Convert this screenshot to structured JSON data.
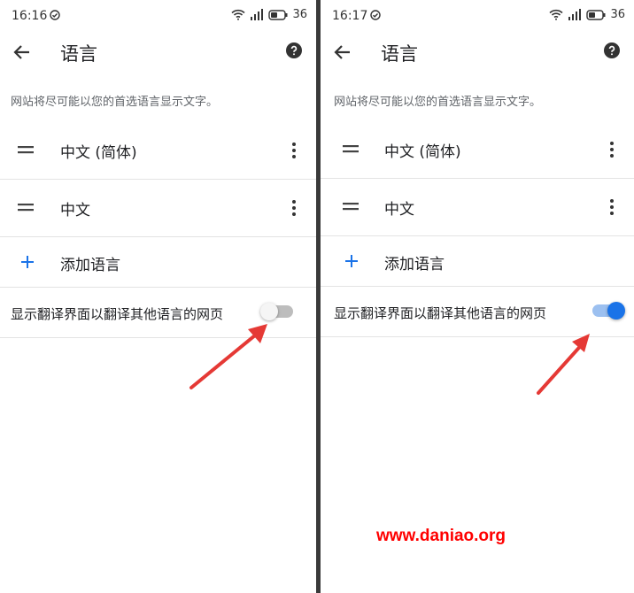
{
  "left": {
    "status": {
      "time": "16:16",
      "battery": "36"
    },
    "title": "语言",
    "description": "网站将尽可能以您的首选语言显示文字。",
    "languages": [
      {
        "label": "中文 (简体)"
      },
      {
        "label": "中文"
      }
    ],
    "add_language": "添加语言",
    "translate_toggle": {
      "label": "显示翻译界面以翻译其他语言的网页",
      "state": "off"
    }
  },
  "right": {
    "status": {
      "time": "16:17",
      "battery": "36"
    },
    "title": "语言",
    "description": "网站将尽可能以您的首选语言显示文字。",
    "languages": [
      {
        "label": "中文 (简体)"
      },
      {
        "label": "中文"
      }
    ],
    "add_language": "添加语言",
    "translate_toggle": {
      "label": "显示翻译界面以翻译其他语言的网页",
      "state": "on"
    }
  },
  "watermark": "www.daniao.org",
  "colors": {
    "accent": "#1a73e8",
    "annotation_arrow": "#e53935",
    "divider": "#3a3a3a"
  }
}
